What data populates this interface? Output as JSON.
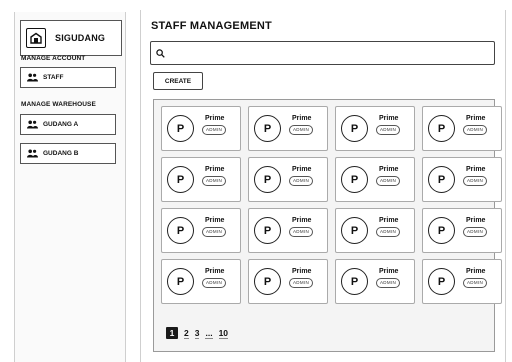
{
  "app": {
    "name": "SIGUDANG"
  },
  "sidebar": {
    "account_section": "MANAGE ACCOUNT",
    "account_items": [
      {
        "label": "STAFF",
        "icon": "users-icon"
      }
    ],
    "warehouse_section": "MANAGE WAREHOUSE",
    "warehouse_items": [
      {
        "label": "GUDANG A",
        "icon": "users-icon"
      },
      {
        "label": "GUDANG B",
        "icon": "users-icon"
      }
    ]
  },
  "main": {
    "title": "STAFF MANAGEMENT",
    "search": {
      "placeholder": "",
      "value": ""
    },
    "create_label": "CREATE",
    "staff_cards": [
      {
        "initial": "P",
        "name": "Prime",
        "role": "ADMIN"
      },
      {
        "initial": "P",
        "name": "Prime",
        "role": "ADMIN"
      },
      {
        "initial": "P",
        "name": "Prime",
        "role": "ADMIN"
      },
      {
        "initial": "P",
        "name": "Prime",
        "role": "ADMIN"
      },
      {
        "initial": "P",
        "name": "Prime",
        "role": "ADMIN"
      },
      {
        "initial": "P",
        "name": "Prime",
        "role": "ADMIN"
      },
      {
        "initial": "P",
        "name": "Prime",
        "role": "ADMIN"
      },
      {
        "initial": "P",
        "name": "Prime",
        "role": "ADMIN"
      },
      {
        "initial": "P",
        "name": "Prime",
        "role": "ADMIN"
      },
      {
        "initial": "P",
        "name": "Prime",
        "role": "ADMIN"
      },
      {
        "initial": "P",
        "name": "Prime",
        "role": "ADMIN"
      },
      {
        "initial": "P",
        "name": "Prime",
        "role": "ADMIN"
      },
      {
        "initial": "P",
        "name": "Prime",
        "role": "ADMIN"
      },
      {
        "initial": "P",
        "name": "Prime",
        "role": "ADMIN"
      },
      {
        "initial": "P",
        "name": "Prime",
        "role": "ADMIN"
      },
      {
        "initial": "P",
        "name": "Prime",
        "role": "ADMIN"
      }
    ],
    "pagination": {
      "pages": [
        "1",
        "2",
        "3",
        "...",
        "10"
      ],
      "active": "1"
    }
  }
}
